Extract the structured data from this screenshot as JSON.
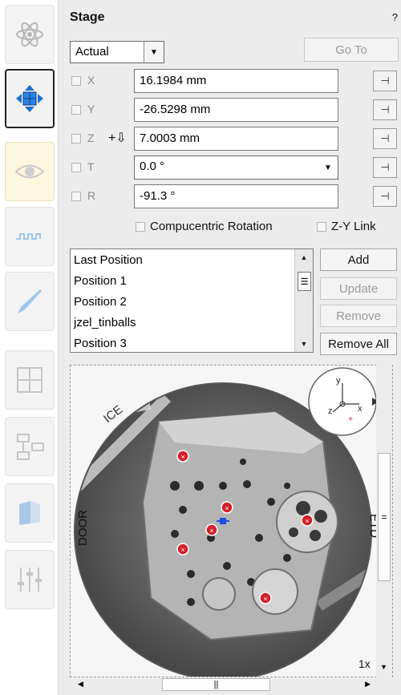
{
  "panel": {
    "title": "Stage",
    "help": "?"
  },
  "position_mode": {
    "selected": "Actual"
  },
  "goto_label": "Go To",
  "axes": [
    {
      "label": "X",
      "value": "16.1984 mm"
    },
    {
      "label": "Y",
      "value": "-26.5298 mm"
    },
    {
      "label": "Z",
      "value": "7.0003 mm",
      "prefix": "+⇩"
    },
    {
      "label": "T",
      "value": "0.0 °"
    },
    {
      "label": "R",
      "value": "-91.3 °"
    }
  ],
  "options": {
    "compucentric": "Compucentric Rotation",
    "zy_link": "Z-Y Link"
  },
  "positions": [
    "Last Position",
    "Position 1",
    "Position 2",
    "jzel_tinballs",
    "Position 3"
  ],
  "buttons": {
    "add": "Add",
    "update": "Update",
    "remove": "Remove",
    "remove_all": "Remove All"
  },
  "navigation": {
    "labels": {
      "ice": "ICE",
      "door": "DOOR",
      "etd": "ETD"
    },
    "axis_labels": {
      "y": "y",
      "z": "z",
      "x": "x"
    },
    "zoom": "1x"
  },
  "toolbar_icons": [
    "atom-icon",
    "stage-move-icon",
    "eye-icon",
    "wave-icon",
    "pen-icon",
    "grid-icon",
    "flow-icon",
    "book-icon",
    "sliders-icon"
  ],
  "colors": {
    "accent": "#1f6fd1",
    "marker": "#d4202a",
    "panel_bg": "#ececec"
  }
}
